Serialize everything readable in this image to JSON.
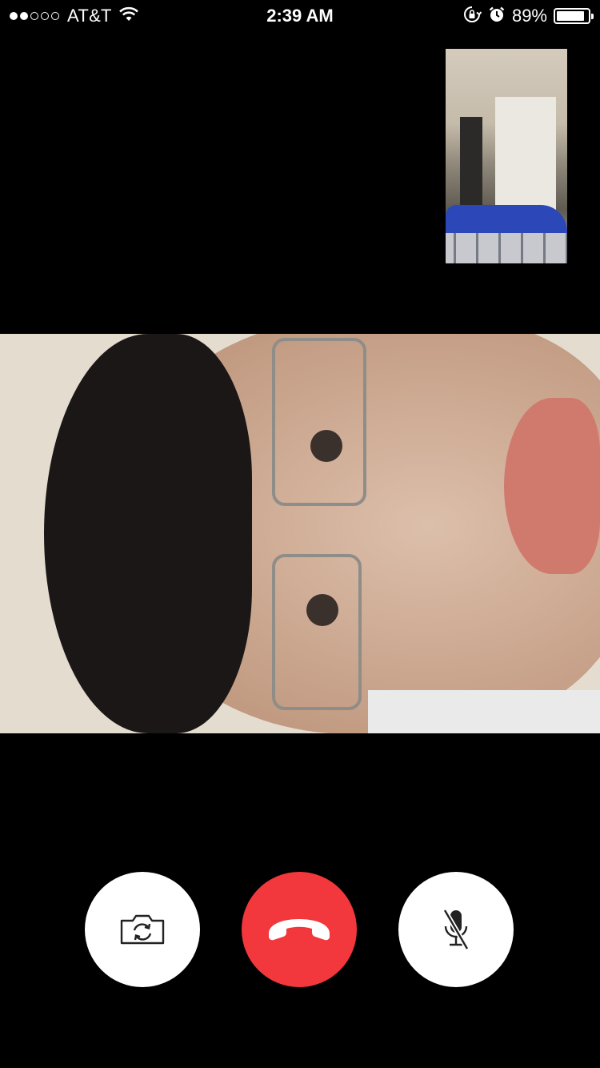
{
  "status_bar": {
    "carrier": "AT&T",
    "signal_bars_filled": 2,
    "signal_bars_total": 5,
    "time": "2:39 AM",
    "battery_percent": "89%",
    "battery_level": 0.89,
    "icons": [
      "wifi-icon",
      "orientation-lock-icon",
      "alarm-icon",
      "battery-icon"
    ]
  },
  "call": {
    "self_preview": "self-video-preview",
    "remote_video": "remote-participant-video"
  },
  "controls": [
    {
      "name": "flip-camera-button",
      "icon": "camera-flip-icon"
    },
    {
      "name": "end-call-button",
      "icon": "phone-hangup-icon"
    },
    {
      "name": "mute-button",
      "icon": "microphone-muted-icon"
    }
  ],
  "colors": {
    "end_call": "#f2383c",
    "control_bg": "#ffffff",
    "background": "#000000"
  }
}
